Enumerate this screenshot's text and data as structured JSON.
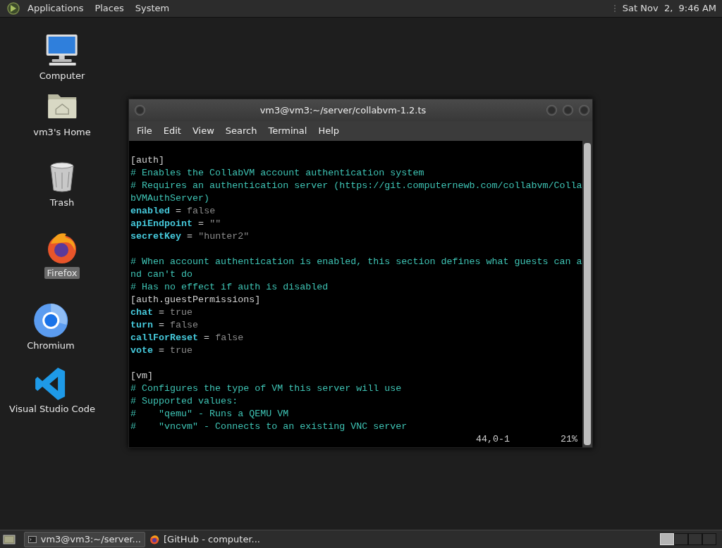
{
  "top_panel": {
    "menus": [
      "Applications",
      "Places",
      "System"
    ],
    "clock": "Sat Nov  2,  9:46 AM"
  },
  "desktop_icons": [
    {
      "kind": "computer",
      "label": "Computer",
      "selected": false
    },
    {
      "kind": "home",
      "label": "vm3's Home",
      "selected": false
    },
    {
      "kind": "trash",
      "label": "Trash",
      "selected": false
    },
    {
      "kind": "firefox",
      "label": "Firefox",
      "selected": true
    },
    {
      "kind": "chromium",
      "label": "Chromium",
      "selected": false
    },
    {
      "kind": "vscode",
      "label": "Visual Studio Code",
      "selected": false
    }
  ],
  "window": {
    "title": "vm3@vm3:~/server/collabvm-1.2.ts",
    "menu": [
      "File",
      "Edit",
      "View",
      "Search",
      "Terminal",
      "Help"
    ],
    "lines": [
      {
        "kind": "blank"
      },
      {
        "kind": "text",
        "segments": [
          {
            "kind": "section",
            "text": "[auth]"
          }
        ]
      },
      {
        "kind": "text",
        "segments": [
          {
            "kind": "comment",
            "text": "# Enables the CollabVM account authentication system"
          }
        ]
      },
      {
        "kind": "text",
        "segments": [
          {
            "kind": "comment",
            "text": "# Requires an authentication server (https://git.computernewb.com/collabvm/Colla"
          }
        ]
      },
      {
        "kind": "text",
        "segments": [
          {
            "kind": "comment",
            "text": "bVMAuthServer)"
          }
        ]
      },
      {
        "kind": "text",
        "segments": [
          {
            "kind": "key",
            "text": "enabled"
          },
          {
            "kind": "op",
            "text": "="
          },
          {
            "kind": "value",
            "text": "false"
          }
        ]
      },
      {
        "kind": "text",
        "segments": [
          {
            "kind": "key",
            "text": "apiEndpoint"
          },
          {
            "kind": "op",
            "text": "="
          },
          {
            "kind": "value",
            "text": "\"\""
          }
        ]
      },
      {
        "kind": "text",
        "segments": [
          {
            "kind": "key",
            "text": "secretKey"
          },
          {
            "kind": "op",
            "text": "="
          },
          {
            "kind": "value",
            "text": "\"hunter2\""
          }
        ]
      },
      {
        "kind": "blank"
      },
      {
        "kind": "text",
        "segments": [
          {
            "kind": "comment",
            "text": "# When account authentication is enabled, this section defines what guests can a"
          }
        ]
      },
      {
        "kind": "text",
        "segments": [
          {
            "kind": "comment",
            "text": "nd can't do"
          }
        ]
      },
      {
        "kind": "text",
        "segments": [
          {
            "kind": "comment",
            "text": "# Has no effect if auth is disabled"
          }
        ]
      },
      {
        "kind": "text",
        "segments": [
          {
            "kind": "section",
            "text": "[auth.guestPermissions]"
          }
        ]
      },
      {
        "kind": "text",
        "segments": [
          {
            "kind": "key",
            "text": "chat"
          },
          {
            "kind": "op",
            "text": "="
          },
          {
            "kind": "value",
            "text": "true"
          }
        ]
      },
      {
        "kind": "text",
        "segments": [
          {
            "kind": "key",
            "text": "turn"
          },
          {
            "kind": "op",
            "text": "="
          },
          {
            "kind": "value",
            "text": "false"
          }
        ]
      },
      {
        "kind": "text",
        "segments": [
          {
            "kind": "key",
            "text": "callForReset"
          },
          {
            "kind": "op",
            "text": "="
          },
          {
            "kind": "value",
            "text": "false"
          }
        ]
      },
      {
        "kind": "text",
        "segments": [
          {
            "kind": "key",
            "text": "vote"
          },
          {
            "kind": "op",
            "text": "="
          },
          {
            "kind": "value",
            "text": "true"
          }
        ]
      },
      {
        "kind": "blank"
      },
      {
        "kind": "text",
        "segments": [
          {
            "kind": "section",
            "text": "[vm]"
          }
        ]
      },
      {
        "kind": "text",
        "segments": [
          {
            "kind": "comment",
            "text": "# Configures the type of VM this server will use"
          }
        ]
      },
      {
        "kind": "text",
        "segments": [
          {
            "kind": "comment",
            "text": "# Supported values:"
          }
        ]
      },
      {
        "kind": "text",
        "segments": [
          {
            "kind": "comment",
            "text": "#    \"qemu\" - Runs a QEMU VM"
          }
        ]
      },
      {
        "kind": "text",
        "segments": [
          {
            "kind": "comment",
            "text": "#    \"vncvm\" - Connects to an existing VNC server"
          }
        ]
      }
    ],
    "status": {
      "position": "44,0-1",
      "percent": "21%"
    }
  },
  "taskbar": {
    "tasks": [
      {
        "kind": "terminal",
        "label": "vm3@vm3:~/server...",
        "selected": true
      },
      {
        "kind": "firefox",
        "label": "[GitHub - computer...",
        "selected": false
      }
    ],
    "workspaces": [
      {
        "selected": true
      },
      {
        "selected": false
      },
      {
        "selected": false
      },
      {
        "selected": false
      }
    ]
  }
}
